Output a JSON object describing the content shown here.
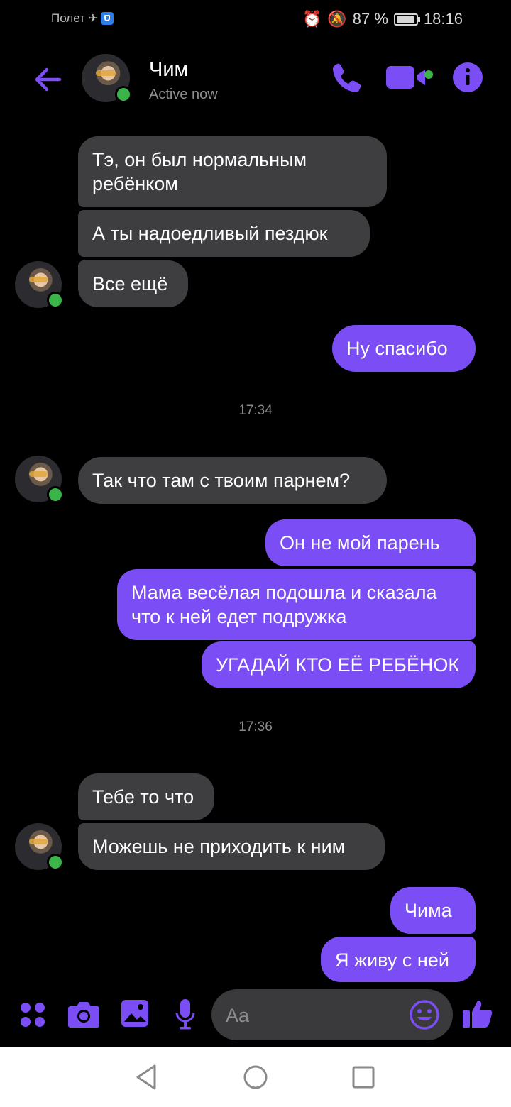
{
  "status_bar": {
    "left_text": "Полет",
    "battery": "87 %",
    "time": "18:16"
  },
  "header": {
    "contact_name": "Чим",
    "presence": "Active now"
  },
  "messages": [
    {
      "dir": "in",
      "text": "Тэ, он был нормальным\nребёнком"
    },
    {
      "dir": "in",
      "text": "А ты надоедливый пездюк"
    },
    {
      "dir": "in",
      "text": "Все ещё"
    },
    {
      "dir": "out",
      "text": "Ну спасибо"
    },
    {
      "type": "timestamp",
      "text": "17:34"
    },
    {
      "dir": "in",
      "text": "Так что там с твоим парнем?"
    },
    {
      "dir": "out",
      "text": "Он не мой парень"
    },
    {
      "dir": "out",
      "text": "Мама весёлая подошла и сказала\nчто к ней едет подружка"
    },
    {
      "dir": "out",
      "text": "УГАДАЙ КТО ЕЁ РЕБЁНОК"
    },
    {
      "type": "timestamp",
      "text": "17:36"
    },
    {
      "dir": "in",
      "text": "Тебе то что"
    },
    {
      "dir": "in",
      "text": "Можешь не приходить к ним"
    },
    {
      "dir": "out",
      "text": "Чима"
    },
    {
      "dir": "out",
      "text": "Я живу с ней"
    }
  ],
  "composer": {
    "placeholder": "Aa"
  },
  "colors": {
    "accent": "#7b4df5",
    "incoming_bubble": "#3e3e40",
    "online": "#3bb54a",
    "background": "#000000"
  },
  "icons": [
    "back-arrow-icon",
    "phone-icon",
    "video-camera-icon",
    "info-icon",
    "apps-icon",
    "camera-icon",
    "gallery-icon",
    "microphone-icon",
    "emoji-icon",
    "thumbs-up-icon",
    "nav-back-icon",
    "nav-home-icon",
    "nav-recents-icon"
  ]
}
